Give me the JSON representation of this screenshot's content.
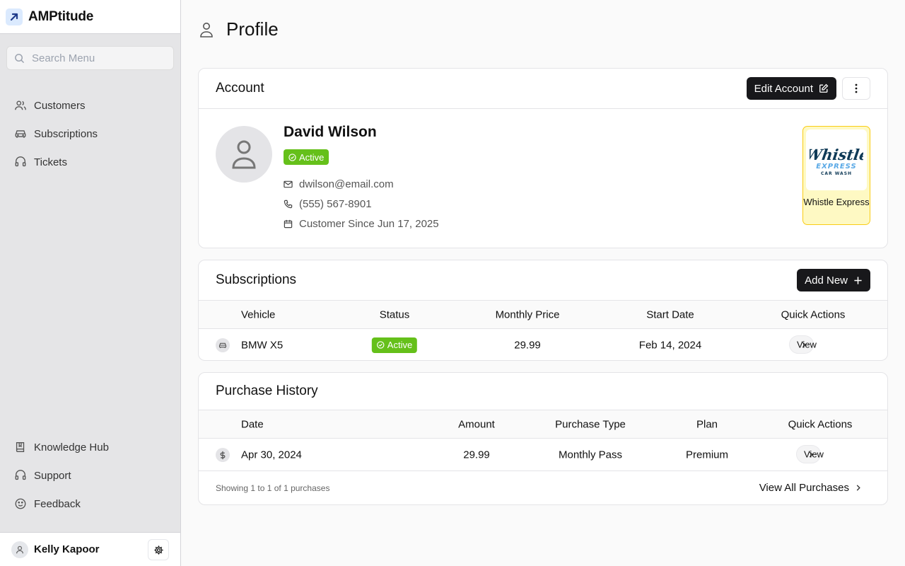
{
  "app": {
    "name": "AMPtitude"
  },
  "search": {
    "placeholder": "Search Menu"
  },
  "nav": {
    "top": [
      {
        "label": "Customers",
        "icon": "users-icon"
      },
      {
        "label": "Subscriptions",
        "icon": "car-icon"
      },
      {
        "label": "Tickets",
        "icon": "headset-icon"
      }
    ],
    "bottom": [
      {
        "label": "Knowledge Hub",
        "icon": "book-icon"
      },
      {
        "label": "Support",
        "icon": "headset-icon"
      },
      {
        "label": "Feedback",
        "icon": "smile-icon"
      }
    ]
  },
  "user": {
    "name": "Kelly Kapoor"
  },
  "page": {
    "title": "Profile"
  },
  "account": {
    "title": "Account",
    "edit_label": "Edit Account",
    "customer_name": "David Wilson",
    "status": "Active",
    "email": "dwilson@email.com",
    "phone": "(555) 567-8901",
    "customer_since": "Customer Since Jun 17, 2025",
    "partner": {
      "name": "Whistle Express",
      "logo_text_main": "Whistle",
      "logo_text_sub": "EXPRESS",
      "logo_text_small": "CAR WASH"
    }
  },
  "subscriptions": {
    "title": "Subscriptions",
    "add_label": "Add New",
    "columns": [
      "Vehicle",
      "Status",
      "Monthly Price",
      "Start Date",
      "Quick Actions"
    ],
    "rows": [
      {
        "vehicle": "BMW X5",
        "status": "Active",
        "price": "29.99",
        "start": "Feb 14, 2024",
        "action": "View"
      }
    ]
  },
  "purchases": {
    "title": "Purchase History",
    "columns": [
      "Date",
      "Amount",
      "Purchase Type",
      "Plan",
      "Quick Actions"
    ],
    "rows": [
      {
        "date": "Apr 30, 2024",
        "amount": "29.99",
        "type": "Monthly Pass",
        "plan": "Premium",
        "action": "View"
      }
    ],
    "footer_text": "Showing 1 to 1 of 1 purchases",
    "view_all_label": "View All Purchases"
  },
  "colors": {
    "accent_dark": "#18181b",
    "status_active": "#65c01a",
    "partner_bg": "#fef9c3",
    "brand_logo": "#1e3a8a"
  }
}
